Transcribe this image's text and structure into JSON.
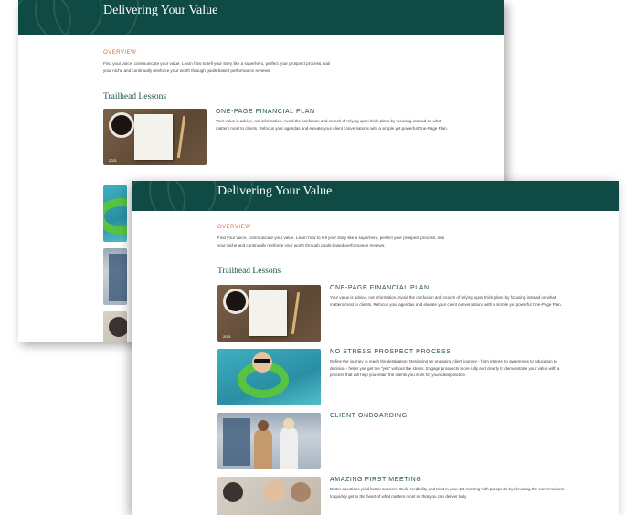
{
  "banner": {
    "title": "Delivering Your Value"
  },
  "overview": {
    "label": "OVERVIEW",
    "text": "Find your voice, communicate your value. Learn how to tell your story like a superhero, perfect your prospect process, nail your niche and continually reinforce your worth through goals-based performance reviews."
  },
  "section_title": "Trailhead Lessons",
  "lessons": [
    {
      "title": "ONE-PAGE FINANCIAL PLAN",
      "desc": "Your value is advice, not information. Avoid the confusion and crunch of relying upon thick plans by focusing instead on what matters most to clients. Refocus your agendas and elevate your client conversations with a simple yet powerful One-Page Plan.",
      "thumb_year": "2021",
      "icon": "notebook-desk-image"
    },
    {
      "title": "NO STRESS PROSPECT PROCESS",
      "desc": "Define the journey to reach the destination. Designing an engaging client journey - from interest to awareness to education to decision - helps you get the \"yes\" without the stress. Engage prospects more fully and clearly to demonstrate your value with a process that will help you retain the clients you work for your ideal practice.",
      "icon": "pool-float-image"
    },
    {
      "title": "CLIENT ONBOARDING",
      "desc": "",
      "icon": "office-couple-image"
    },
    {
      "title": "AMAZING FIRST MEETING",
      "desc": "Better questions yield better answers. Build credibility and trust in your 1st meeting with prospects by elevating the conversations to quickly get to the heart of what matters most so that you can deliver truly",
      "icon": "meeting-people-image"
    }
  ],
  "colors": {
    "banner": "#0f4a44",
    "accent": "#d2703a",
    "heading": "#1f4f4a"
  }
}
